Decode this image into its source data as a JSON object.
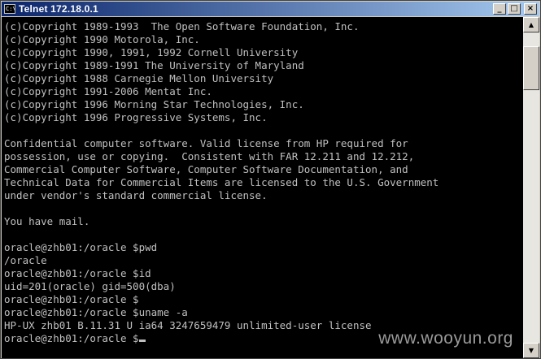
{
  "window": {
    "title": "Telnet 172.18.0.1",
    "icon": "C:\\",
    "minimize_glyph": "_",
    "maximize_glyph": "□",
    "close_glyph": "×"
  },
  "terminal": {
    "lines": [
      "(c)Copyright 1989-1993  The Open Software Foundation, Inc.",
      "(c)Copyright 1990 Motorola, Inc.",
      "(c)Copyright 1990, 1991, 1992 Cornell University",
      "(c)Copyright 1989-1991 The University of Maryland",
      "(c)Copyright 1988 Carnegie Mellon University",
      "(c)Copyright 1991-2006 Mentat Inc.",
      "(c)Copyright 1996 Morning Star Technologies, Inc.",
      "(c)Copyright 1996 Progressive Systems, Inc.",
      "",
      "Confidential computer software. Valid license from HP required for",
      "possession, use or copying.  Consistent with FAR 12.211 and 12.212,",
      "Commercial Computer Software, Computer Software Documentation, and",
      "Technical Data for Commercial Items are licensed to the U.S. Government",
      "under vendor's standard commercial license.",
      "",
      "You have mail.",
      "",
      "oracle@zhb01:/oracle $pwd",
      "/oracle",
      "oracle@zhb01:/oracle $id",
      "uid=201(oracle) gid=500(dba)",
      "oracle@zhb01:/oracle $",
      "oracle@zhb01:/oracle $uname -a",
      "HP-UX zhb01 B.11.31 U ia64 3247659479 unlimited-user license"
    ],
    "prompt": "oracle@zhb01:/oracle $",
    "text_color": "#c0c0c0",
    "background_color": "#000000"
  },
  "watermark": "www.wooyun.org",
  "scrollbar": {
    "up_glyph": "▲",
    "down_glyph": "▼"
  },
  "colors": {
    "titlebar_start": "#0a246a",
    "titlebar_end": "#a6caf0",
    "chrome": "#d4d0c8"
  }
}
